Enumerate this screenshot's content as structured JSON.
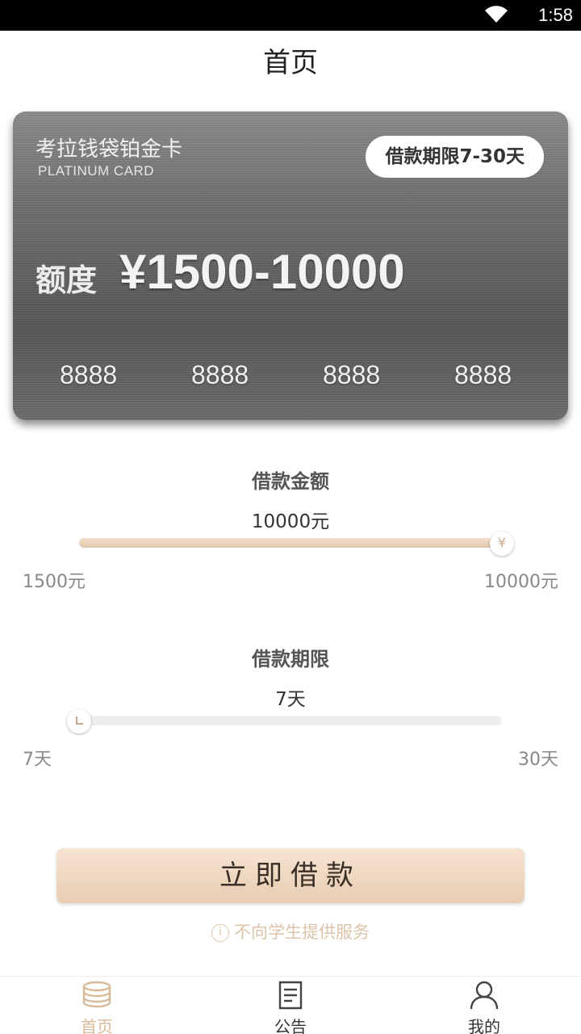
{
  "status_bar": {
    "time": "1:58"
  },
  "header": {
    "title": "首页"
  },
  "card": {
    "name": "考拉钱袋铂金卡",
    "subtitle": "PLATINUM CARD",
    "term_badge": "借款期限7-30天",
    "limit_label": "额度",
    "limit_value": "¥1500-10000",
    "numbers": [
      "8888",
      "8888",
      "8888",
      "8888"
    ]
  },
  "amount_slider": {
    "title": "借款金额",
    "value_text": "10000元",
    "min_label": "1500元",
    "max_label": "10000元",
    "thumb_symbol": "¥",
    "fraction": 1.0
  },
  "term_slider": {
    "title": "借款期限",
    "value_text": "7天",
    "min_label": "7天",
    "max_label": "30天",
    "fraction": 0.0
  },
  "apply_button": {
    "label": "立即借款"
  },
  "notice": {
    "icon": "info-icon",
    "text": "不向学生提供服务"
  },
  "tabbar": {
    "items": [
      {
        "label": "首页",
        "icon": "coins-icon",
        "active": true
      },
      {
        "label": "公告",
        "icon": "document-icon",
        "active": false
      },
      {
        "label": "我的",
        "icon": "user-icon",
        "active": false
      }
    ]
  },
  "colors": {
    "accent": "#d8b998",
    "button": "#eed7c1"
  }
}
